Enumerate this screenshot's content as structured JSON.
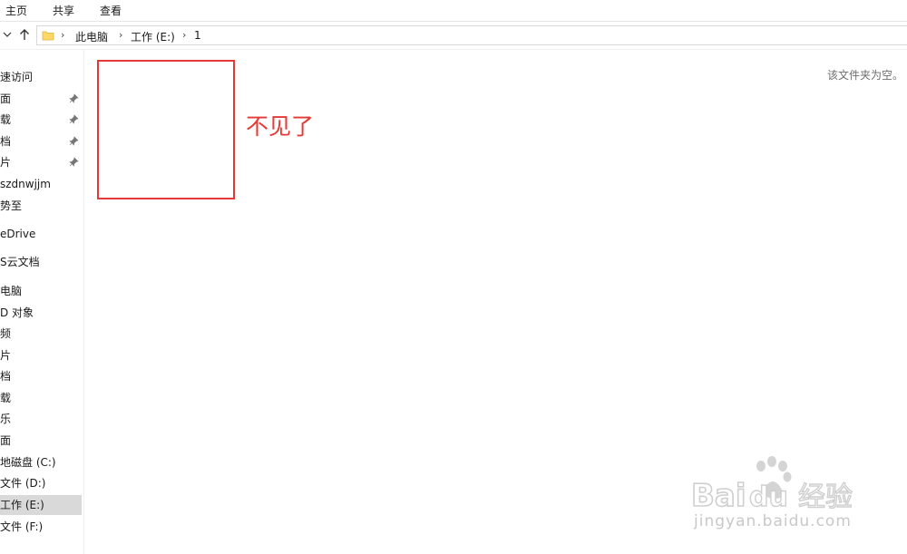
{
  "ribbon": {
    "tabs": [
      "主页",
      "共享",
      "查看"
    ]
  },
  "address": {
    "crumbs": [
      "此电脑",
      "工作 (E:)",
      "1"
    ]
  },
  "sidebar": {
    "items": [
      {
        "label": "速访问",
        "pinned": false
      },
      {
        "label": "面",
        "pinned": true
      },
      {
        "label": "载",
        "pinned": true
      },
      {
        "label": "档",
        "pinned": true
      },
      {
        "label": "片",
        "pinned": true
      },
      {
        "label": "szdnwjjm",
        "pinned": false
      },
      {
        "label": "势至",
        "pinned": false
      },
      {
        "label": "eDrive",
        "pinned": false
      },
      {
        "label": "S云文档",
        "pinned": false
      },
      {
        "label": "电脑",
        "pinned": false
      },
      {
        "label": "D 对象",
        "pinned": false
      },
      {
        "label": "频",
        "pinned": false
      },
      {
        "label": "片",
        "pinned": false
      },
      {
        "label": "档",
        "pinned": false
      },
      {
        "label": "载",
        "pinned": false
      },
      {
        "label": "乐",
        "pinned": false
      },
      {
        "label": "面",
        "pinned": false
      },
      {
        "label": "地磁盘 (C:)",
        "pinned": false
      },
      {
        "label": "文件 (D:)",
        "pinned": false
      },
      {
        "label": "工作 (E:)",
        "pinned": false,
        "selected": true
      },
      {
        "label": "文件 (F:)",
        "pinned": false
      }
    ]
  },
  "content": {
    "empty_message": "该文件夹为空。",
    "annotation_text": "不见了"
  },
  "watermark": {
    "url_text": "jingyan.baidu.com",
    "logo_text": "Bai du 经验"
  },
  "colors": {
    "annotation": "#e53935",
    "selected_bg": "#d9d9d9",
    "folder": "#ffd766"
  }
}
